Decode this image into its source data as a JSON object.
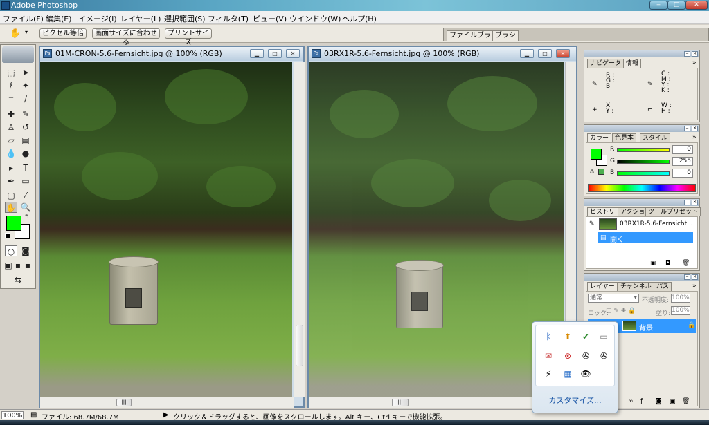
{
  "app": {
    "title": "Adobe Photoshop"
  },
  "menu": [
    "ファイル(F)",
    "編集(E)",
    "イメージ(I)",
    "レイヤー(L)",
    "選択範囲(S)",
    "フィルタ(T)",
    "ビュー(V)",
    "ウインドウ(W)",
    "ヘルプ(H)"
  ],
  "options": {
    "btn1": "ピクセル等倍",
    "btn2": "画面サイズに合わせる",
    "btn3": "プリントサイズ",
    "tab1": "ファイルブラウザ",
    "tab2": "ブラシ"
  },
  "docs": [
    {
      "title": "01M-CRON-5.6-Fernsicht.jpg @ 100% (RGB)"
    },
    {
      "title": "03RX1R-5.6-Fernsicht.jpg @ 100% (RGB)"
    }
  ],
  "panels": {
    "nav": {
      "tab1": "ナビゲータ",
      "tab2": "情報",
      "rgb": "R :\nG :\nB :",
      "cmyk": "C :\nM :\nY :\nK :",
      "xy": "X :\nY :",
      "wh": "W :\nH :"
    },
    "color": {
      "tab1": "カラー",
      "tab2": "色見本",
      "tab3": "スタイル",
      "r_label": "R",
      "g_label": "G",
      "b_label": "B",
      "r_val": "0",
      "g_val": "255",
      "b_val": "0",
      "fg": "#00ff00"
    },
    "history": {
      "tab1": "ヒストリー",
      "tab2": "アクション",
      "tab3": "ツールプリセット",
      "item1": "03RX1R-5.6-Fernsicht...",
      "item2": "開く"
    },
    "layers": {
      "tab1": "レイヤー",
      "tab2": "チャンネル",
      "tab3": "パス",
      "blend": "通常",
      "opacity_label": "不透明度:",
      "opacity": "100%",
      "lock_label": "ロック:",
      "fill_label": "塗り:",
      "fill": "100%",
      "layer_name": "背景"
    }
  },
  "status": {
    "zoom": "100%",
    "file": "ファイル: 68.7M/68.7M",
    "hint": "クリック＆ドラッグすると、画像をスクロールします。Alt キー、Ctrl キーで機能拡張。"
  },
  "tray": {
    "customize": "カスタマイズ..."
  },
  "colors": {
    "foreground": "#00ff00",
    "background": "#ffffff",
    "accent": "#3399ff"
  }
}
